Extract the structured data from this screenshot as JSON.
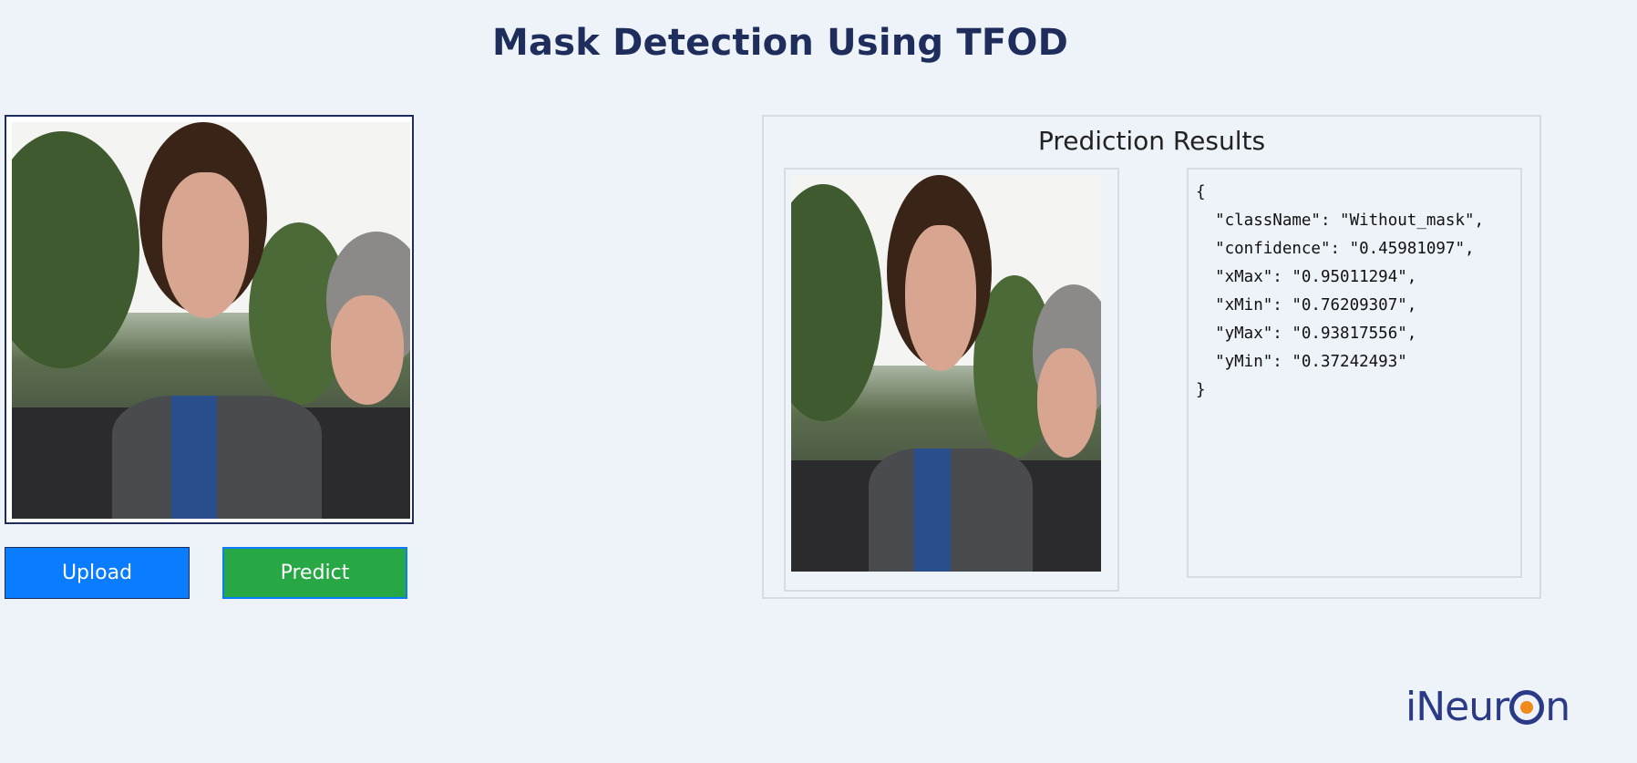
{
  "header": {
    "title": "Mask Detection Using TFOD"
  },
  "upload_panel": {
    "image_alt": "uploaded photo",
    "upload_label": "Upload",
    "predict_label": "Predict"
  },
  "results": {
    "title": "Prediction Results",
    "image_alt": "prediction image",
    "json_lines": [
      "{",
      "  \"className\": \"Without_mask\",",
      "  \"confidence\": \"0.45981097\",",
      "  \"xMax\": \"0.95011294\",",
      "  \"xMin\": \"0.76209307\",",
      "  \"yMax\": \"0.93817556\",",
      "  \"yMin\": \"0.37242493\"",
      "}"
    ],
    "prediction": {
      "className": "Without_mask",
      "confidence": "0.45981097",
      "xMax": "0.95011294",
      "xMin": "0.76209307",
      "yMax": "0.93817556",
      "yMin": "0.37242493"
    }
  },
  "logo": {
    "text_prefix": "iNeur",
    "text_suffix": "n"
  },
  "colors": {
    "background": "#eef2f9",
    "title": "#1f2d5c",
    "upload_button": "#0a7cff",
    "predict_button": "#28a745",
    "logo_blue": "#2b3a86",
    "logo_orange": "#f08a1a"
  }
}
